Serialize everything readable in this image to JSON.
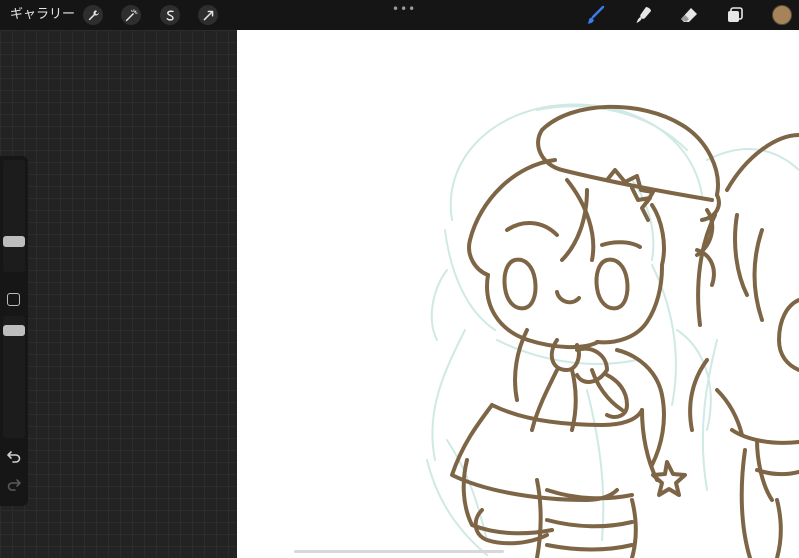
{
  "toolbar": {
    "gallery_label": "ギャラリー",
    "left_icons": [
      "wrench-icon",
      "magic-wand-icon",
      "selection-icon",
      "transform-arrow-icon"
    ],
    "more_label": "•••",
    "right_tools": [
      "brush-icon",
      "smudge-icon",
      "eraser-icon",
      "layers-icon"
    ],
    "active_tool": "brush-icon",
    "colors": {
      "active_tool": "#3b7cf0",
      "inactive_tool": "#e6e6e6",
      "current_color": "#a6835a"
    }
  },
  "sidebar": {
    "size_level": 0.25,
    "opacity_level": 0.92,
    "icons": [
      "modifier-square-icon",
      "undo-icon",
      "redo-icon"
    ]
  },
  "canvas": {
    "sketch_color": "#7d6546",
    "guide_color": "#cfe9e4"
  }
}
